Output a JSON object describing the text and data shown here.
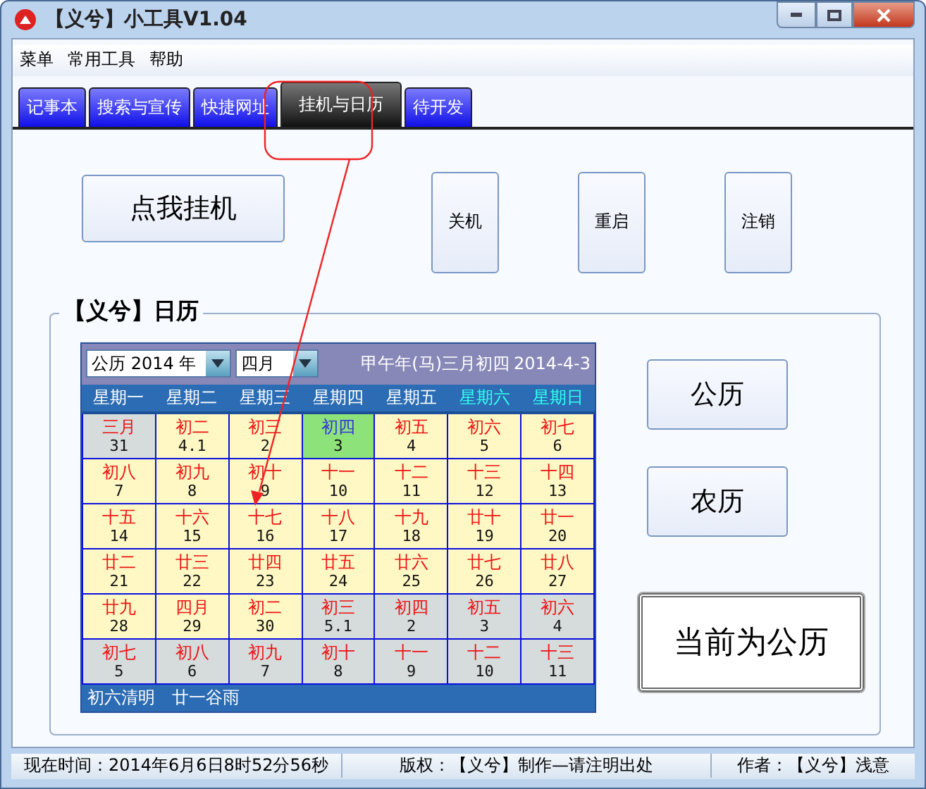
{
  "window": {
    "title": "【义兮】小工具V1.04"
  },
  "menu": [
    "菜单",
    "常用工具",
    "帮助"
  ],
  "tabs": [
    {
      "label": "记事本",
      "selected": false
    },
    {
      "label": "搜索与宣传",
      "selected": false
    },
    {
      "label": "快捷网址",
      "selected": false
    },
    {
      "label": "挂机与日历",
      "selected": true
    },
    {
      "label": "待开发",
      "selected": false
    }
  ],
  "hangup_button": "点我挂机",
  "power_buttons": [
    "关机",
    "重启",
    "注销"
  ],
  "calendar_group": {
    "title": "【义兮】日历"
  },
  "calendar": {
    "year_select": "公历 2014 年",
    "month_select": "四月",
    "lunar_date": "甲午年(马)三月初四",
    "solar_date": "2014-4-3",
    "weekdays": [
      {
        "label": "星期一",
        "weekend": false
      },
      {
        "label": "星期二",
        "weekend": false
      },
      {
        "label": "星期三",
        "weekend": false
      },
      {
        "label": "星期四",
        "weekend": false
      },
      {
        "label": "星期五",
        "weekend": false
      },
      {
        "label": "星期六",
        "weekend": true
      },
      {
        "label": "星期日",
        "weekend": true
      }
    ],
    "weeks": [
      [
        {
          "lunar": "三月",
          "day": "31",
          "kind": "other"
        },
        {
          "lunar": "初二",
          "day": "4.1",
          "kind": "current"
        },
        {
          "lunar": "初三",
          "day": "2",
          "kind": "current"
        },
        {
          "lunar": "初四",
          "day": "3",
          "kind": "today"
        },
        {
          "lunar": "初五",
          "day": "4",
          "kind": "current"
        },
        {
          "lunar": "初六",
          "day": "5",
          "kind": "current"
        },
        {
          "lunar": "初七",
          "day": "6",
          "kind": "current"
        }
      ],
      [
        {
          "lunar": "初八",
          "day": "7",
          "kind": "current"
        },
        {
          "lunar": "初九",
          "day": "8",
          "kind": "current"
        },
        {
          "lunar": "初十",
          "day": "9",
          "kind": "current"
        },
        {
          "lunar": "十一",
          "day": "10",
          "kind": "current"
        },
        {
          "lunar": "十二",
          "day": "11",
          "kind": "current"
        },
        {
          "lunar": "十三",
          "day": "12",
          "kind": "current"
        },
        {
          "lunar": "十四",
          "day": "13",
          "kind": "current"
        }
      ],
      [
        {
          "lunar": "十五",
          "day": "14",
          "kind": "current"
        },
        {
          "lunar": "十六",
          "day": "15",
          "kind": "current"
        },
        {
          "lunar": "十七",
          "day": "16",
          "kind": "current"
        },
        {
          "lunar": "十八",
          "day": "17",
          "kind": "current"
        },
        {
          "lunar": "十九",
          "day": "18",
          "kind": "current"
        },
        {
          "lunar": "廿十",
          "day": "19",
          "kind": "current"
        },
        {
          "lunar": "廿一",
          "day": "20",
          "kind": "current"
        }
      ],
      [
        {
          "lunar": "廿二",
          "day": "21",
          "kind": "current"
        },
        {
          "lunar": "廿三",
          "day": "22",
          "kind": "current"
        },
        {
          "lunar": "廿四",
          "day": "23",
          "kind": "current"
        },
        {
          "lunar": "廿五",
          "day": "24",
          "kind": "current"
        },
        {
          "lunar": "廿六",
          "day": "25",
          "kind": "current"
        },
        {
          "lunar": "廿七",
          "day": "26",
          "kind": "current"
        },
        {
          "lunar": "廿八",
          "day": "27",
          "kind": "current"
        }
      ],
      [
        {
          "lunar": "廿九",
          "day": "28",
          "kind": "current"
        },
        {
          "lunar": "四月",
          "day": "29",
          "kind": "current"
        },
        {
          "lunar": "初二",
          "day": "30",
          "kind": "current"
        },
        {
          "lunar": "初三",
          "day": "5.1",
          "kind": "other"
        },
        {
          "lunar": "初四",
          "day": "2",
          "kind": "other"
        },
        {
          "lunar": "初五",
          "day": "3",
          "kind": "other"
        },
        {
          "lunar": "初六",
          "day": "4",
          "kind": "other"
        }
      ],
      [
        {
          "lunar": "初七",
          "day": "5",
          "kind": "other"
        },
        {
          "lunar": "初八",
          "day": "6",
          "kind": "other"
        },
        {
          "lunar": "初九",
          "day": "7",
          "kind": "other"
        },
        {
          "lunar": "初十",
          "day": "8",
          "kind": "other"
        },
        {
          "lunar": "十一",
          "day": "9",
          "kind": "other"
        },
        {
          "lunar": "十二",
          "day": "10",
          "kind": "other"
        },
        {
          "lunar": "十三",
          "day": "11",
          "kind": "other"
        }
      ]
    ],
    "solar_terms": [
      "初六清明",
      "廿一谷雨"
    ]
  },
  "mode_buttons": [
    "公历",
    "农历"
  ],
  "mode_status": "当前为公历",
  "status_bar": [
    "现在时间：2014年6月6日8时52分56秒",
    "版权：【义兮】制作—请注明出处",
    "作者：【义兮】浅意"
  ]
}
